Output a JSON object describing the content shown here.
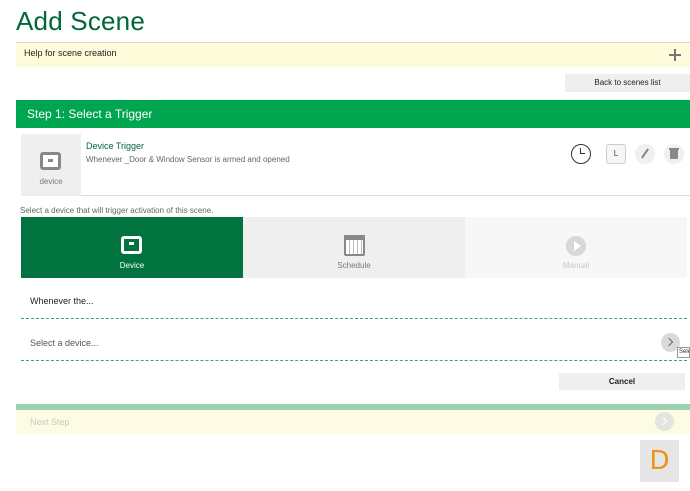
{
  "page": {
    "title": "Add Scene"
  },
  "help": {
    "text": "Help for scene creation",
    "icon": "plus-icon"
  },
  "nav": {
    "back_label": "Back to scenes list"
  },
  "step": {
    "title": "Step 1: Select a Trigger"
  },
  "trigger": {
    "thumb_label": "device",
    "title": "Device Trigger",
    "description": "Whenever _Door & Window Sensor is armed and opened",
    "label_button": "L"
  },
  "instruction": "Select a device that will trigger activation of this scene.",
  "tabs": [
    {
      "label": "Device",
      "icon": "device-icon",
      "selected": true
    },
    {
      "label": "Schedule",
      "icon": "calendar-icon",
      "selected": false
    },
    {
      "label": "Manual",
      "icon": "play-icon",
      "selected": false
    }
  ],
  "form": {
    "whenever_label": "Whenever the...",
    "select_placeholder": "Select a device...",
    "tooltip": "Sele",
    "cancel_label": "Cancel"
  },
  "next": {
    "label": "Next Step"
  },
  "badge": {
    "letter": "D"
  },
  "colors": {
    "brand_green": "#00a550",
    "dark_green": "#00733f",
    "help_bg": "#fdfbd9",
    "badge_orange": "#f29016"
  }
}
